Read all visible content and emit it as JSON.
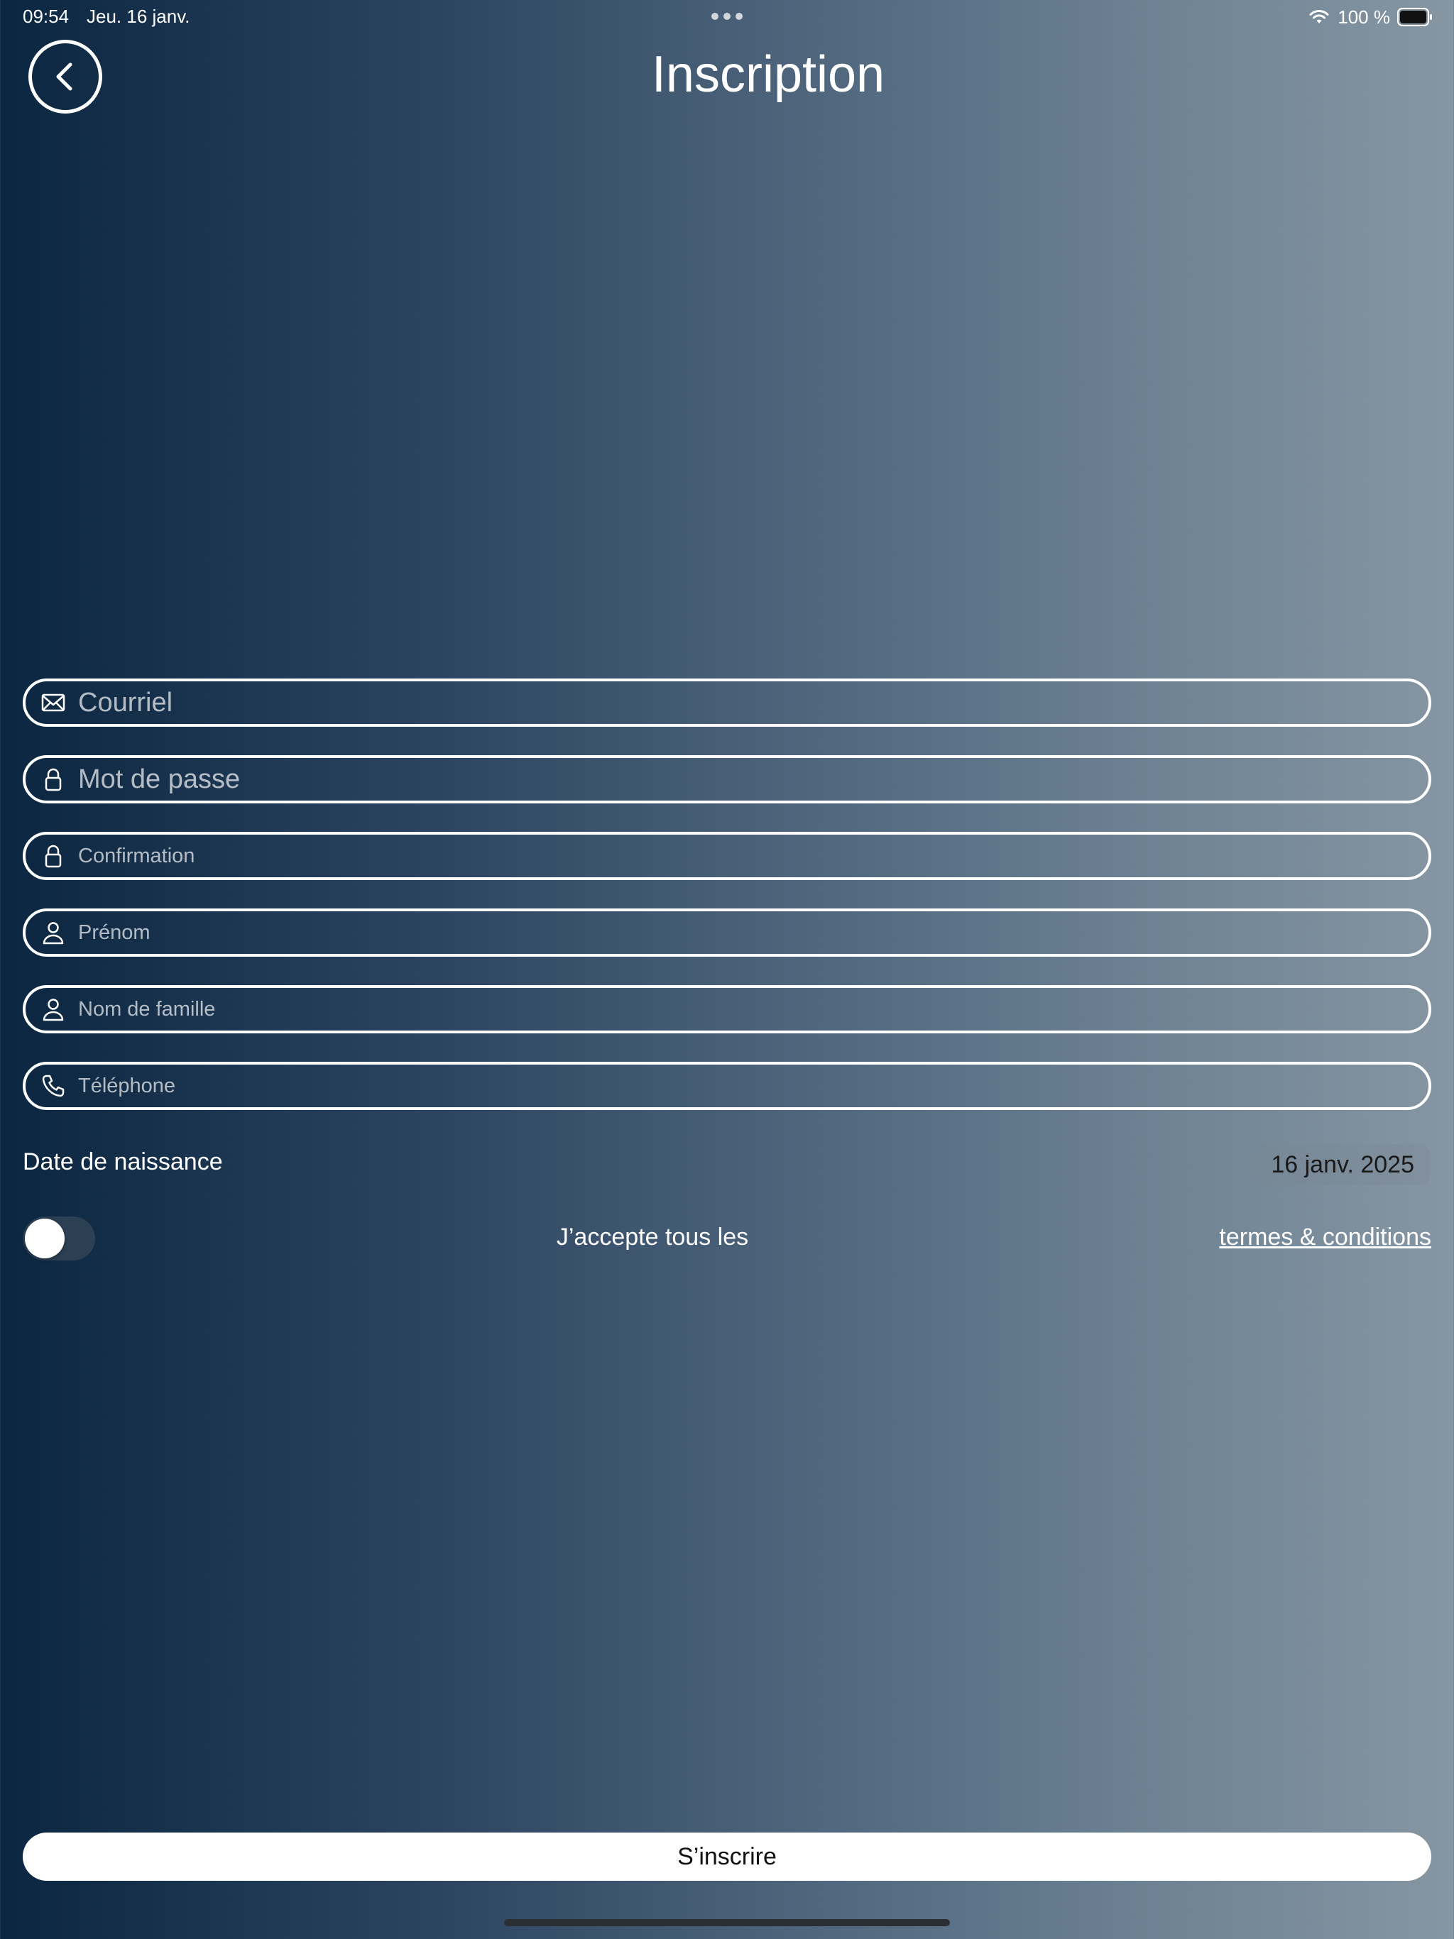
{
  "status_bar": {
    "time": "09:54",
    "date": "Jeu. 16 janv.",
    "battery_percent": "100 %",
    "icons": [
      "wifi-icon",
      "battery-icon"
    ]
  },
  "header": {
    "title": "Inscription",
    "back_icon": "chevron-left-icon"
  },
  "form": {
    "email": {
      "placeholder": "Courriel",
      "value": "",
      "icon": "envelope-icon"
    },
    "password": {
      "placeholder": "Mot de passe",
      "value": "",
      "icon": "lock-icon"
    },
    "confirmation": {
      "placeholder": "Confirmation",
      "value": "",
      "icon": "lock-icon"
    },
    "first_name": {
      "placeholder": "Prénom",
      "value": "",
      "icon": "person-icon"
    },
    "last_name": {
      "placeholder": "Nom de famille",
      "value": "",
      "icon": "person-icon"
    },
    "phone": {
      "placeholder": "Téléphone",
      "value": "",
      "icon": "phone-icon"
    },
    "birth_date": {
      "label": "Date de naissance",
      "value": "16 janv. 2025"
    },
    "terms": {
      "accepted": false,
      "text": "J’accepte tous les",
      "link_text": "termes & conditions"
    }
  },
  "submit": {
    "label": "S’inscrire"
  },
  "colors": {
    "gradient_start": "#0b2640",
    "gradient_end": "#8696a3",
    "text": "#ffffff",
    "button_bg": "#ffffff",
    "button_text": "#111111"
  }
}
